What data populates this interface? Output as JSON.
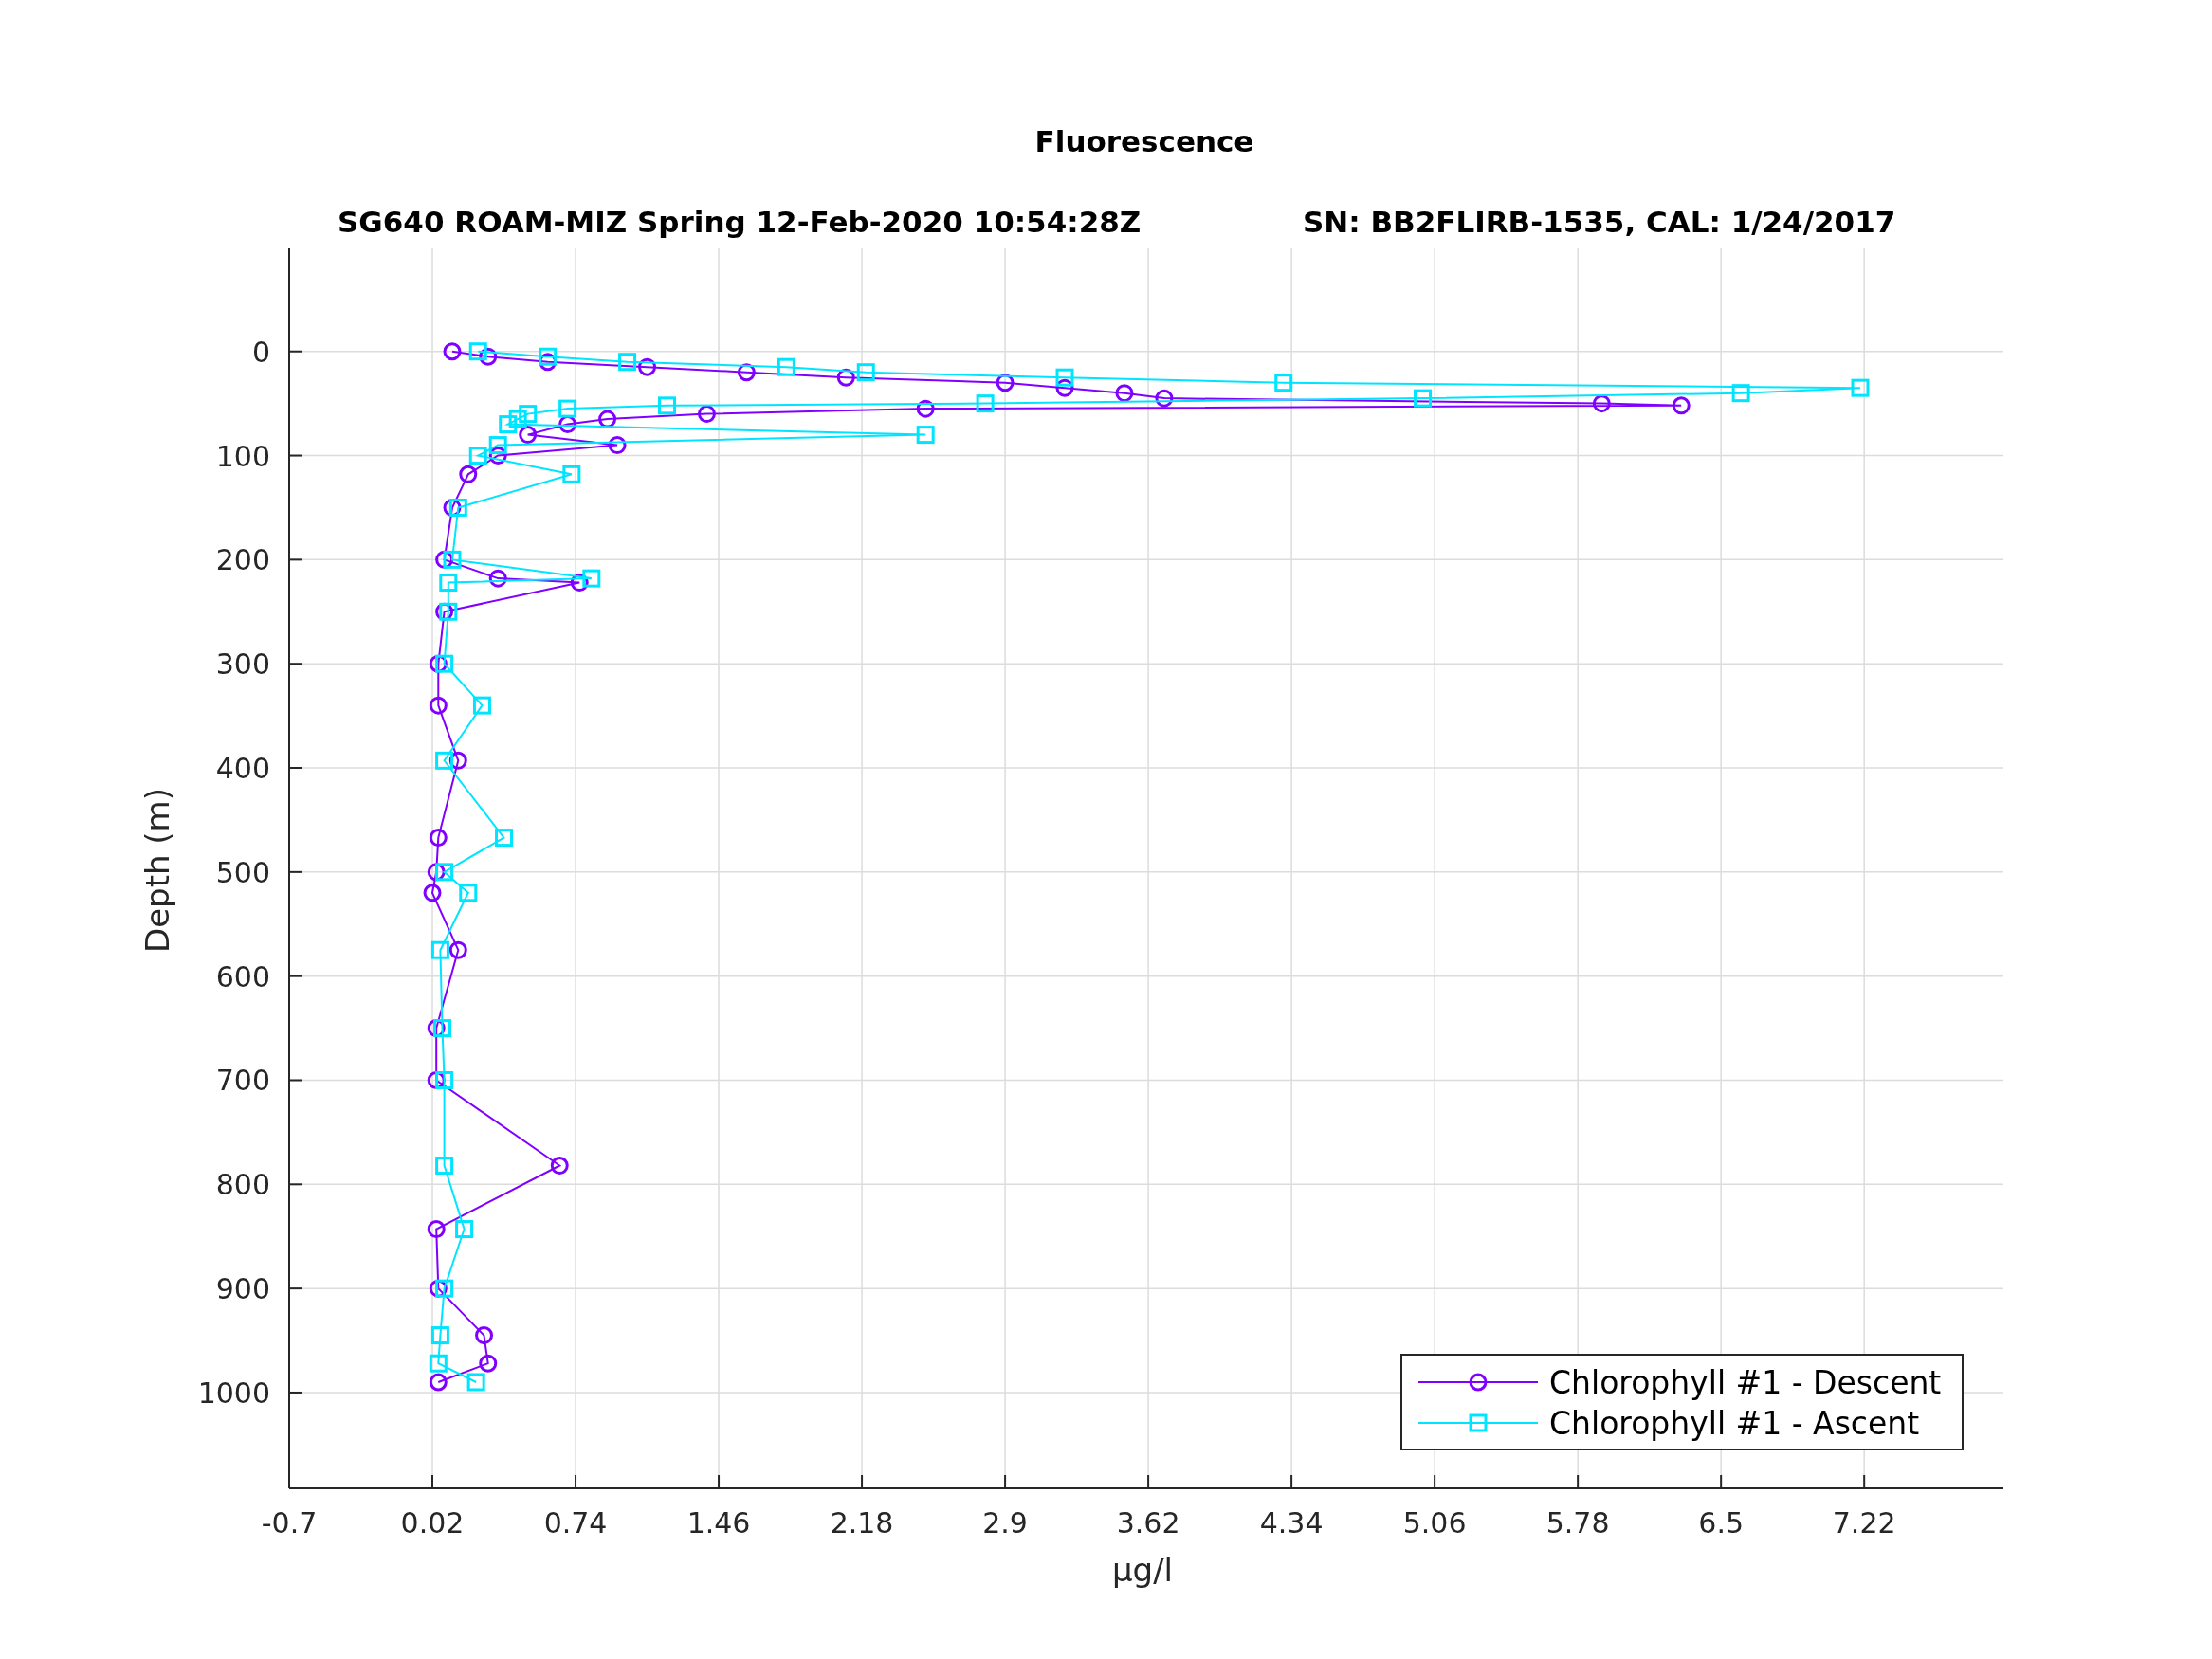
{
  "subtitle": {
    "left": "SG640 ROAM-MIZ Spring 12-Feb-2020 10:54:28Z",
    "right": "SN: BB2FLIRB-1535, CAL: 1/24/2017"
  },
  "chart_data": {
    "type": "line",
    "orientation": "horizontal",
    "title": "Fluorescence",
    "xlabel": "μg/l",
    "ylabel": "Depth (m)",
    "x": [
      0,
      5,
      10,
      15,
      20,
      25,
      30,
      35,
      40,
      45,
      50,
      52,
      55,
      60,
      65,
      70,
      80,
      90,
      100,
      118,
      150,
      200,
      218,
      222,
      250,
      300,
      340,
      393,
      467,
      500,
      520,
      575,
      650,
      700,
      782,
      843,
      900,
      945,
      972,
      990
    ],
    "series": [
      {
        "name": "Chlorophyll #1 - Descent",
        "color": "#8000ff",
        "marker": "o",
        "values": [
          0.12,
          0.3,
          0.6,
          1.1,
          1.6,
          2.1,
          2.9,
          3.2,
          3.5,
          3.7,
          5.9,
          6.3,
          2.5,
          1.4,
          0.9,
          0.7,
          0.5,
          0.95,
          0.35,
          0.2,
          0.12,
          0.08,
          0.35,
          0.76,
          0.08,
          0.05,
          0.05,
          0.15,
          0.05,
          0.04,
          0.02,
          0.15,
          0.04,
          0.04,
          0.66,
          0.04,
          0.05,
          0.28,
          0.3,
          0.05
        ]
      },
      {
        "name": "Chlorophyll #1 - Ascent",
        "color": "#00e5ff",
        "marker": "s",
        "values": [
          0.25,
          0.6,
          1.0,
          1.8,
          2.2,
          3.2,
          4.3,
          7.2,
          6.6,
          5.0,
          2.8,
          1.2,
          0.7,
          0.5,
          0.45,
          0.4,
          2.5,
          0.35,
          0.25,
          0.72,
          0.15,
          0.12,
          0.82,
          0.1,
          0.1,
          0.08,
          0.27,
          0.08,
          0.38,
          0.08,
          0.2,
          0.06,
          0.07,
          0.08,
          0.08,
          0.18,
          0.08,
          0.06,
          0.05,
          0.24
        ]
      }
    ],
    "grid": true,
    "legend": true,
    "xlim": [
      -0.7,
      7.92
    ],
    "ylim": [
      1092,
      -99
    ],
    "xticks": [
      {
        "value": -0.7,
        "label": "-0.7"
      },
      {
        "value": 0.02,
        "label": "0.02"
      },
      {
        "value": 0.74,
        "label": "0.74"
      },
      {
        "value": 1.46,
        "label": "1.46"
      },
      {
        "value": 2.18,
        "label": "2.18"
      },
      {
        "value": 2.9,
        "label": "2.9"
      },
      {
        "value": 3.62,
        "label": "3.62"
      },
      {
        "value": 4.34,
        "label": "4.34"
      },
      {
        "value": 5.06,
        "label": "5.06"
      },
      {
        "value": 5.78,
        "label": "5.78"
      },
      {
        "value": 6.5,
        "label": "6.5"
      },
      {
        "value": 7.22,
        "label": "7.22"
      }
    ],
    "yticks": [
      0,
      100,
      200,
      300,
      400,
      500,
      600,
      700,
      800,
      900,
      1000
    ]
  }
}
